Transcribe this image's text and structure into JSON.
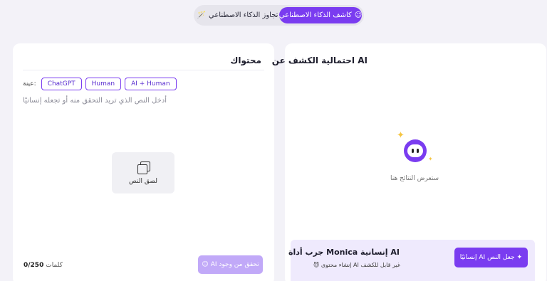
{
  "mode_toggle": {
    "bypass_label": "تجاوز الذكاء الاصطناعي",
    "detector_label": "كاشف الذكاء الاصطناعي"
  },
  "input_panel": {
    "title": "محتواك",
    "sample_label": "عينة:",
    "samples": [
      "ChatGPT",
      "Human",
      "AI + Human"
    ],
    "placeholder": "أدخل النص الذي تريد التحقق منه أو تجعله إنسانيًا",
    "paste_label": "لصق النص",
    "word_count_value": "0/250",
    "word_count_unit": "كلمات",
    "check_button_label": "AI تحقق من وجود"
  },
  "result_panel": {
    "title": "AI احتمالية الكشف عن",
    "results_hint": "ستعرض النتائج هنا"
  },
  "promo": {
    "title": "AI إنسانية Monica جرب أداة",
    "subtitle": "غير قابل للكشف AI إنشاء محتوى",
    "humanize_button_label": "إنسانيًا AI جعل النص"
  },
  "icons": {
    "bypass": "magic-wand-icon",
    "detector": "robot-icon",
    "paste": "copy-icon",
    "mascot": "monica-mascot-icon",
    "sparkle": "sparkle-icon"
  },
  "colors": {
    "accent": "#7a3cf0",
    "accent_disabled": "#c1a9f8",
    "promo_bg": "#efeafd",
    "page_bg": "#f3f2f8"
  }
}
